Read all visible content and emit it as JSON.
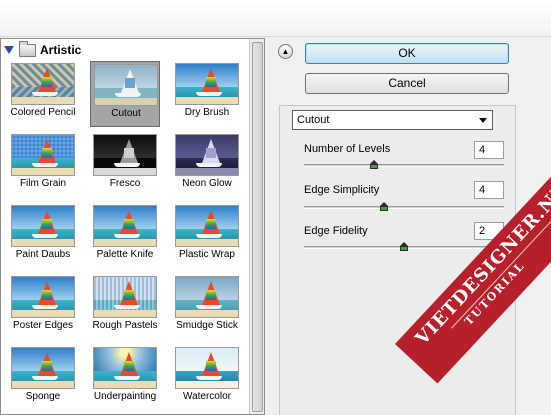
{
  "gallery": {
    "title": "Artistic",
    "filters": [
      {
        "label": "Colored Pencil",
        "style": "pencil"
      },
      {
        "label": "Cutout",
        "style": "cutout",
        "selected": true
      },
      {
        "label": "Dry Brush",
        "style": "plain"
      },
      {
        "label": "Film Grain",
        "style": "grain"
      },
      {
        "label": "Fresco",
        "style": "dark"
      },
      {
        "label": "Neon Glow",
        "style": "neon"
      },
      {
        "label": "Paint Daubs",
        "style": "plain"
      },
      {
        "label": "Palette Knife",
        "style": "plain"
      },
      {
        "label": "Plastic Wrap",
        "style": "plain"
      },
      {
        "label": "Poster Edges",
        "style": "plain"
      },
      {
        "label": "Rough Pastels",
        "style": "rough"
      },
      {
        "label": "Smudge Stick",
        "style": "smudge"
      },
      {
        "label": "Sponge",
        "style": "plain"
      },
      {
        "label": "Underpainting",
        "style": "under"
      },
      {
        "label": "Watercolor",
        "style": "water"
      }
    ]
  },
  "buttons": {
    "ok": "OK",
    "cancel": "Cancel"
  },
  "filter_select": {
    "value": "Cutout"
  },
  "params": [
    {
      "label": "Number of Levels",
      "value": "4",
      "slider_fraction": 0.35
    },
    {
      "label": "Edge Simplicity",
      "value": "4",
      "slider_fraction": 0.4
    },
    {
      "label": "Edge Fidelity",
      "value": "2",
      "slider_fraction": 0.5
    }
  ],
  "watermark": {
    "line1": "VIETDESIGNER.NET",
    "line2": "TUTORIAL"
  },
  "colors": {
    "ribbon": "#b5202a",
    "selected_cell": "#a5a5a5"
  }
}
